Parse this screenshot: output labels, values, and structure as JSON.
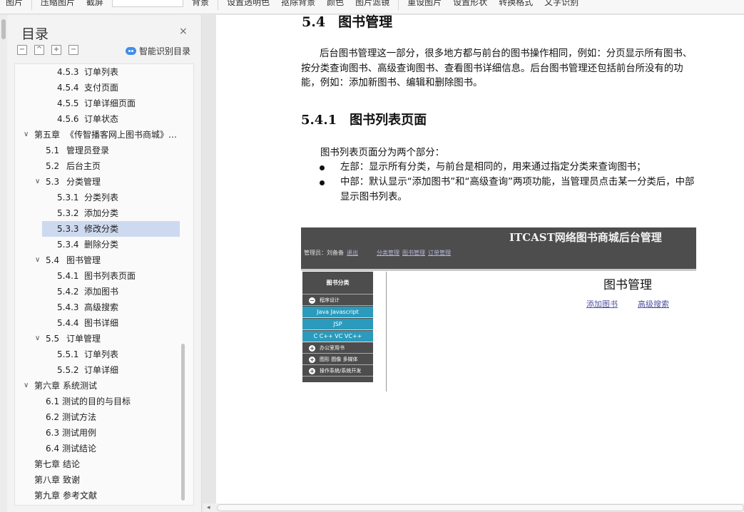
{
  "toolbar": {
    "items": [
      "图片",
      "压缩图片",
      "截屏",
      "背景",
      "设置透明色",
      "抠除背景",
      "颜色",
      "图片滤镜",
      "重设图片",
      "设置形状",
      "转换格式",
      "文字识别"
    ]
  },
  "toc": {
    "title": "目录",
    "close_glyph": "×",
    "ctrl_collapse": "−",
    "ctrl_expand": "^",
    "ctrl_add": "+",
    "ctrl_remove": "−",
    "ai_label": "智能识别目录",
    "items": [
      {
        "num": "4.5.3",
        "text": "订单列表"
      },
      {
        "num": "4.5.4",
        "text": "支付页面"
      },
      {
        "num": "4.5.5",
        "text": "订单详细页面"
      },
      {
        "num": "4.5.6",
        "text": "订单状态"
      },
      {
        "num": "第五章",
        "text": "《传智播客网上图书商城》…"
      },
      {
        "num": "5.1",
        "text": "管理员登录"
      },
      {
        "num": "5.2",
        "text": "后台主页"
      },
      {
        "num": "5.3",
        "text": "分类管理"
      },
      {
        "num": "5.3.1",
        "text": "分类列表"
      },
      {
        "num": "5.3.2",
        "text": "添加分类"
      },
      {
        "num": "5.3.3",
        "text": "修改分类"
      },
      {
        "num": "5.3.4",
        "text": "删除分类"
      },
      {
        "num": "5.4",
        "text": "图书管理"
      },
      {
        "num": "5.4.1",
        "text": "图书列表页面"
      },
      {
        "num": "5.4.2",
        "text": "添加图书"
      },
      {
        "num": "5.4.3",
        "text": "高级搜索"
      },
      {
        "num": "5.4.4",
        "text": "图书详细"
      },
      {
        "num": "5.5",
        "text": "订单管理"
      },
      {
        "num": "5.5.1",
        "text": "订单列表"
      },
      {
        "num": "5.5.2",
        "text": "订单详细"
      },
      {
        "num": "第六章",
        "text": "系统测试"
      },
      {
        "num": "6.1",
        "text": "测试的目的与目标"
      },
      {
        "num": "6.2",
        "text": "测试方法"
      },
      {
        "num": "6.3",
        "text": "测试用例"
      },
      {
        "num": "6.4",
        "text": "测试结论"
      },
      {
        "num": "第七章",
        "text": "结论"
      },
      {
        "num": "第八章",
        "text": "致谢"
      },
      {
        "num": "第九章",
        "text": "参考文献"
      }
    ]
  },
  "doc": {
    "h2_num": "5.4",
    "h2_text": "图书管理",
    "p1": "后台图书管理这一部分，很多地方都与前台的图书操作相同，例如：分页显示所有图书、按分类查询图书、高级查询图书、查看图书详细信息。后台图书管理还包括前台所没有的功能，例如：添加新图书、编辑和删除图书。",
    "h3_num": "5.4.1",
    "h3_text": "图书列表页面",
    "p2": "图书列表页面分为两个部分：",
    "bullet1": "左部：显示所有分类，与前台是相同的，用来通过指定分类来查询图书；",
    "bullet2": "中部：默认显示“添加图书”和“高级查询”两项功能，当管理员点击某一分类后，中部显示图书列表。"
  },
  "figure": {
    "title": "ITCAST网络图书商城后台管理",
    "admin_label": "管理员：刘备备",
    "logout": "退出",
    "nav": [
      "分类管理",
      "图书管理",
      "订单管理"
    ],
    "side_title": "图书分类",
    "cat_open": "程序设计",
    "subs": [
      "Java Javascript",
      "JSP",
      "C C++ VC VC++"
    ],
    "cats": [
      "办公室用书",
      "图形 图像 多媒体",
      "操作系统/系统开发"
    ],
    "main_title": "图书管理",
    "link_add": "添加图书",
    "link_search": "高级搜索"
  }
}
